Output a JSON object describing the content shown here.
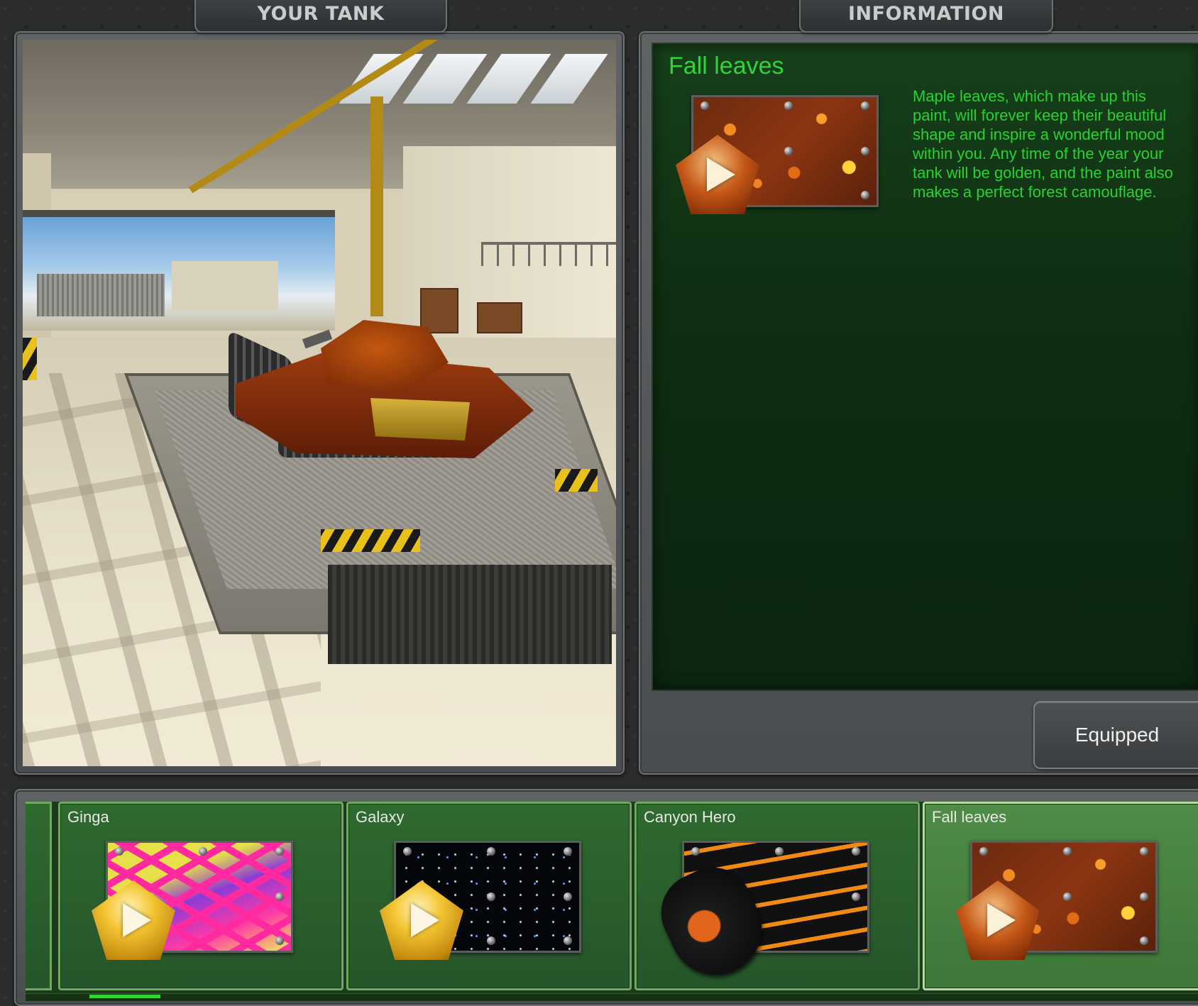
{
  "tabs": {
    "your_tank": "YOUR TANK",
    "information": "INFORMATION"
  },
  "info": {
    "title": "Fall leaves",
    "description": "Maple leaves, which make up this paint, will forever keep their beautiful shape and inspire a wonderful mood within you. Any time of the year your tank will be golden, and the paint also makes a perfect forest camouflage.",
    "preview_icon": "play-pentagon-icon"
  },
  "equip_button": "Equipped",
  "paints": [
    {
      "name": "Ginga",
      "icon": "play-pentagon-icon"
    },
    {
      "name": "Galaxy",
      "icon": "play-pentagon-icon"
    },
    {
      "name": "Canyon Hero",
      "icon": "gaming-mouse-icon"
    },
    {
      "name": "Fall leaves",
      "icon": "play-pentagon-icon",
      "selected": true
    }
  ],
  "colors": {
    "info_text": "#27d232",
    "card_border": "#6fa861",
    "selected_border": "#b3dca0",
    "scroll_thumb": "#36d23a"
  }
}
